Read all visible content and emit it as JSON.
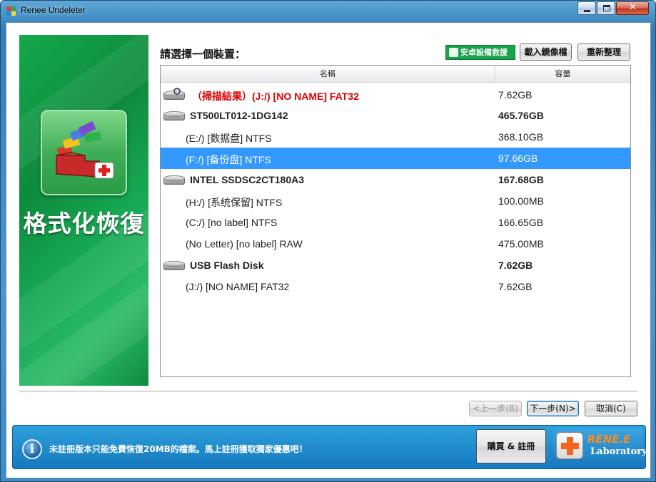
{
  "window": {
    "title": "Renee Undeleter"
  },
  "banner": {
    "title": "格式化恢復"
  },
  "header": {
    "prompt": "請選擇一個裝置：",
    "android_button": "安卓設備救援",
    "load_image_button": "載入鏡像檔",
    "refresh_button": "重新整理"
  },
  "device_list": {
    "columns": {
      "name": "名稱",
      "capacity": "容量"
    },
    "rows": [
      {
        "type": "scan",
        "name": "（掃描結果）(J:/) [NO NAME] FAT32",
        "capacity": "7.62GB"
      },
      {
        "type": "disk",
        "name": "ST500LT012-1DG142",
        "capacity": "465.76GB"
      },
      {
        "type": "partition",
        "name": "(E:/) [数据盘] NTFS",
        "capacity": "368.10GB"
      },
      {
        "type": "partition",
        "name": "(F:/) [备份盘] NTFS",
        "capacity": "97.66GB",
        "selected": true
      },
      {
        "type": "disk",
        "name": "INTEL SSDSC2CT180A3",
        "capacity": "167.68GB"
      },
      {
        "type": "partition",
        "name": "(H:/) [系统保留] NTFS",
        "capacity": "100.00MB"
      },
      {
        "type": "partition",
        "name": "(C:/) [no label] NTFS",
        "capacity": "166.65GB"
      },
      {
        "type": "partition",
        "name": "(No Letter) [no label] RAW",
        "capacity": "475.00MB"
      },
      {
        "type": "disk",
        "name": "USB Flash Disk",
        "capacity": "7.62GB"
      },
      {
        "type": "partition",
        "name": "(J:/) [NO NAME] FAT32",
        "capacity": "7.62GB"
      }
    ]
  },
  "navigation": {
    "back_button": "<上一步(B)",
    "next_button": "下一步(N)>",
    "cancel_button": "取消(C)"
  },
  "footer": {
    "notice": "未註冊版本只能免費恢復20MB的檔案。馬上註冊獲取獨家優惠吧！",
    "buy_button": "購買 & 註冊",
    "brand_name": "RENE.E",
    "brand_sub": "Laboratory"
  },
  "colors": {
    "selection": "#3399ff",
    "scan_result_text": "#e00000",
    "banner_green": "#0d8b3c",
    "footer_blue": "#1e8ccd",
    "brand_orange": "#f26522"
  }
}
